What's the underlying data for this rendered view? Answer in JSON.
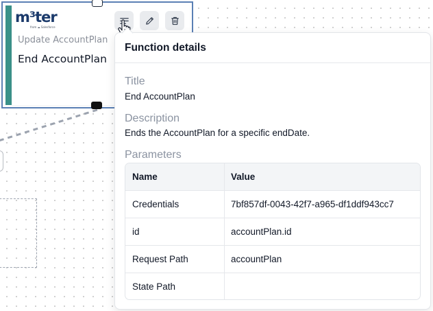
{
  "card": {
    "logo_text": "m³ter",
    "logo_subtext": "from ☁ Salesforce",
    "subtitle": "Update AccountPlan",
    "title": "End AccountPlan"
  },
  "toolbar": {
    "details_icon": "list-details-icon",
    "edit_icon": "pencil-icon",
    "delete_icon": "trash-icon"
  },
  "popover": {
    "heading": "Function details",
    "title_label": "Title",
    "title_value": "End AccountPlan",
    "description_label": "Description",
    "description_value": "Ends the AccountPlan for a specific endDate.",
    "parameters_label": "Parameters",
    "table": {
      "headers": [
        "Name",
        "Value"
      ],
      "rows": [
        {
          "name": "Credentials",
          "value": "7bf857df-0043-42f7-a965-df1ddf943cc7"
        },
        {
          "name": "id",
          "value": "accountPlan.id"
        },
        {
          "name": "Request Path",
          "value": "accountPlan"
        },
        {
          "name": "State Path",
          "value": ""
        }
      ]
    }
  },
  "colors": {
    "card_accent": "#3a9189",
    "card_border": "#5a7fb4",
    "logo": "#1b3a6b"
  }
}
